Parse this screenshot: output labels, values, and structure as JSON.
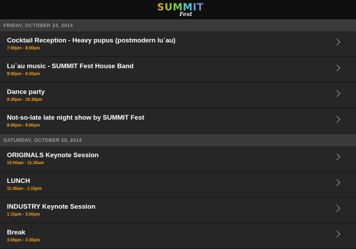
{
  "header": {
    "logo_main": "SUMMIT",
    "logo_sub": "Fest"
  },
  "sections": [
    {
      "date": "FRIDAY, OCTOBER 24, 2014",
      "events": [
        {
          "title": "Cocktail Reception - Heavy pupus (postmodern lu`au)",
          "time": "7:00pm - 8:00pm"
        },
        {
          "title": "Lu`au music - SUMMIT Fest House Band",
          "time": "9:00pm - 9:30pm"
        },
        {
          "title": "Dance party",
          "time": "9:30pm - 10:30pm"
        },
        {
          "title": "Not-so-late late night show by SUMMIT Fest",
          "time": "8:00pm - 9:00pm"
        }
      ]
    },
    {
      "date": "SATURDAY, OCTOBER 25, 2014",
      "events": [
        {
          "title": "ORIGINALS Keynote Session",
          "time": "10:00am - 11:30am"
        },
        {
          "title": "LUNCH",
          "time": "11:45am - 1:15pm"
        },
        {
          "title": "INDUSTRY Keynote Session",
          "time": "1:15pm - 3:00pm"
        },
        {
          "title": "Break",
          "time": "3:00pm - 3:30pm"
        }
      ]
    }
  ],
  "colors": {
    "time_accent": "#f7a21b",
    "row_bg": "#262626",
    "header_bg": "#3a3a3a"
  },
  "icons": {
    "row_chevron": "chevron-right-icon"
  }
}
